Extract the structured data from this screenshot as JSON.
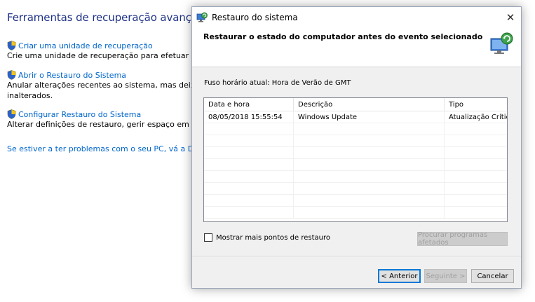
{
  "background": {
    "title": "Ferramentas de recuperação avançadas",
    "items": [
      {
        "link": "Criar uma unidade de recuperação",
        "desc": [
          "Crie uma unidade de recuperação para efetuar a resolu"
        ]
      },
      {
        "link": "Abrir o Restauro do Sistema",
        "desc": [
          "Anular alterações recentes ao sistema, mas deixar fichei",
          "inalterados."
        ]
      },
      {
        "link": "Configurar Restauro do Sistema",
        "desc": [
          "Alterar definições de restauro, gerir espaço em disco e c"
        ]
      }
    ],
    "footer_link": "Se estiver a ter problemas com o seu PC, vá a Definiçõe"
  },
  "dialog": {
    "title": "Restauro do sistema",
    "close": "✕",
    "header": "Restaurar o estado do computador antes do evento selecionado",
    "timezone": "Fuso horário atual: Hora de Verão de GMT",
    "columns": {
      "date": "Data e hora",
      "desc": "Descrição",
      "type": "Tipo"
    },
    "rows": [
      {
        "date": "08/05/2018 15:55:54",
        "desc": "Windows Update",
        "type": "Atualização Crítica"
      }
    ],
    "show_more": "Mostrar mais pontos de restauro",
    "scan_button": "Procurar programas afetados",
    "back_button": "< Anterior",
    "next_button": "Seguinte >",
    "cancel_button": "Cancelar"
  },
  "colors": {
    "link": "#0066cc",
    "title": "#1e3287",
    "focus": "#0078d7"
  }
}
